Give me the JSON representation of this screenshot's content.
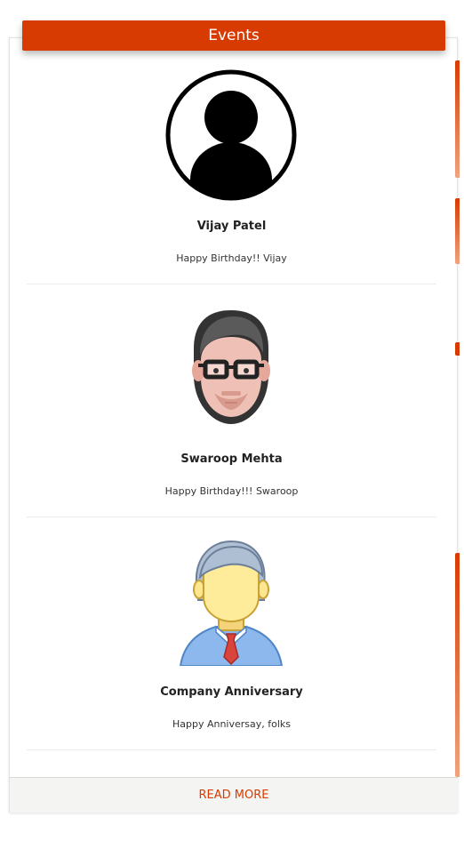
{
  "header": {
    "title": "Events"
  },
  "events": [
    {
      "name": "Vijay Patel",
      "message": "Happy Birthday!! Vijay",
      "avatar_icon": "person-silhouette-icon"
    },
    {
      "name": "Swaroop Mehta",
      "message": "Happy Birthday!!! Swaroop",
      "avatar_icon": "man-with-glasses-icon"
    },
    {
      "name": "Company Anniversary",
      "message": "Happy Anniversay, folks",
      "avatar_icon": "businessman-icon"
    }
  ],
  "footer": {
    "read_more_label": "READ MORE"
  },
  "colors": {
    "accent": "#d83b01",
    "background": "#ffffff",
    "footer_background": "#f4f4f2"
  }
}
